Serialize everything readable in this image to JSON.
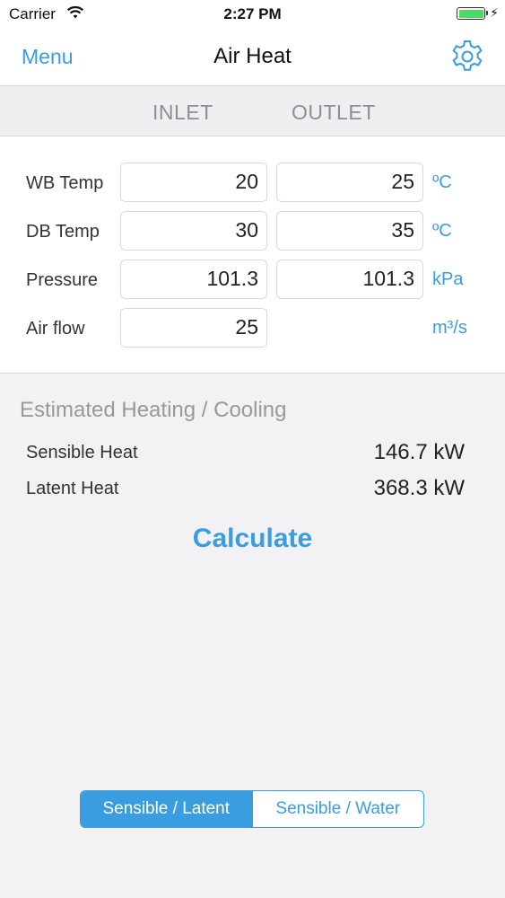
{
  "status_bar": {
    "carrier": "Carrier",
    "time": "2:27 PM",
    "battery_color": "#4cd964"
  },
  "nav": {
    "menu_label": "Menu",
    "title": "Air Heat",
    "settings_icon": "gear-icon"
  },
  "columns": {
    "inlet": "INLET",
    "outlet": "OUTLET"
  },
  "inputs": [
    {
      "label": "WB Temp",
      "inlet": "20",
      "outlet": "25",
      "unit": "ºC"
    },
    {
      "label": "DB Temp",
      "inlet": "30",
      "outlet": "35",
      "unit": "ºC"
    },
    {
      "label": "Pressure",
      "inlet": "101.3",
      "outlet": "101.3",
      "unit": "kPa"
    },
    {
      "label": "Air flow",
      "inlet": "25",
      "unit": "m³/s"
    }
  ],
  "results": {
    "title": "Estimated Heating / Cooling",
    "sensible_label": "Sensible Heat",
    "sensible_value": "146.7 kW",
    "latent_label": "Latent Heat",
    "latent_value": "368.3 kW"
  },
  "calculate_label": "Calculate",
  "segments": [
    {
      "label": "Sensible / Latent",
      "selected": true
    },
    {
      "label": "Sensible / Water",
      "selected": false
    }
  ],
  "colors": {
    "accent": "#3a9de0",
    "background": "#f2f2f4"
  }
}
